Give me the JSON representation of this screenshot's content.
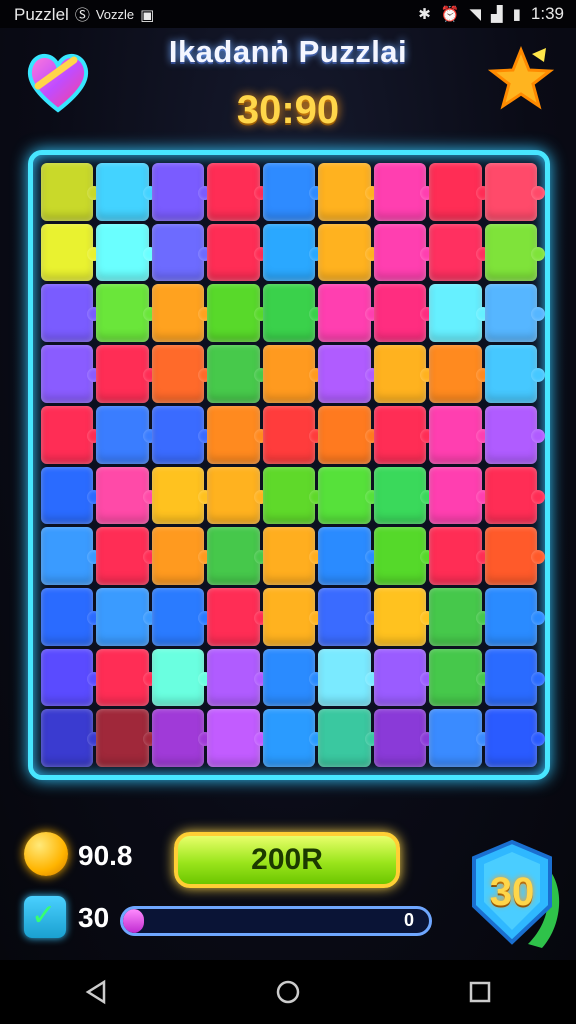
{
  "status_bar": {
    "app_name": "Puzzlel",
    "notification_text": "Vozzle",
    "time": "1:39"
  },
  "header": {
    "title": "Ikadanṅ Puzzlai",
    "timer": "30:90"
  },
  "hud": {
    "coins": "90.8",
    "completed": "30",
    "play_button_label": "200R",
    "progress_end_label": "0",
    "progress_fraction": 0.07,
    "level": "30"
  },
  "board": {
    "columns": 9,
    "rows": 10,
    "colors": [
      "#c9d92a",
      "#43d3ff",
      "#7a5cff",
      "#ff2d55",
      "#2e8bff",
      "#ffb21f",
      "#ff3fb0",
      "#ff2d55",
      "#ff4a6a",
      "#e9f230",
      "#6affff",
      "#6d6bff",
      "#ff2d55",
      "#2aa8ff",
      "#ffb21f",
      "#ff3fb0",
      "#ff3060",
      "#7fe33a",
      "#7a5cff",
      "#6ae63a",
      "#ffa21f",
      "#58d92a",
      "#3ad14b",
      "#ff3fb0",
      "#ff2d80",
      "#66f0ff",
      "#56b6ff",
      "#8a5cff",
      "#ff2d55",
      "#ff6a2a",
      "#47c94b",
      "#ff9a1f",
      "#b05cff",
      "#ffb21f",
      "#ff8a1f",
      "#46c8ff",
      "#ff2d55",
      "#3a7dff",
      "#3a6bff",
      "#ff8a1f",
      "#ff3c3c",
      "#ff7a1f",
      "#ff2d55",
      "#ff3fb0",
      "#b05cff",
      "#2a6bff",
      "#ff4aa8",
      "#ffc21f",
      "#ffb21f",
      "#5fd92a",
      "#56e13a",
      "#3ad95b",
      "#ff3fb0",
      "#ff2d55",
      "#3a9bff",
      "#ff2d55",
      "#ff9a1f",
      "#46c84b",
      "#ffae1f",
      "#2a8bff",
      "#55d92a",
      "#ff2d55",
      "#ff5a2a",
      "#2a6bff",
      "#3a9bff",
      "#2a7bff",
      "#ff2d55",
      "#ffb21f",
      "#3a6bff",
      "#ffc21f",
      "#46c84b",
      "#2a8bff",
      "#5a4bff",
      "#ff2d55",
      "#6affe0",
      "#b05cff",
      "#2a8bff",
      "#7aeaff",
      "#9a5cff",
      "#46c84b",
      "#2a6bff",
      "#3a3bd0",
      "#a0283a",
      "#a03ad8",
      "#c25cff",
      "#2a9bff",
      "#3ac8a0",
      "#8a3ad8",
      "#3a8bff",
      "#2a5bff"
    ]
  },
  "colors": {
    "board_border": "#48e6ff",
    "timer": "#ffd64a",
    "play_button": "#9be51c"
  },
  "icons": [
    "heart-icon",
    "star-icon",
    "coin-icon",
    "check-icon",
    "shield-level-icon",
    "back-icon",
    "home-icon",
    "recents-icon"
  ]
}
